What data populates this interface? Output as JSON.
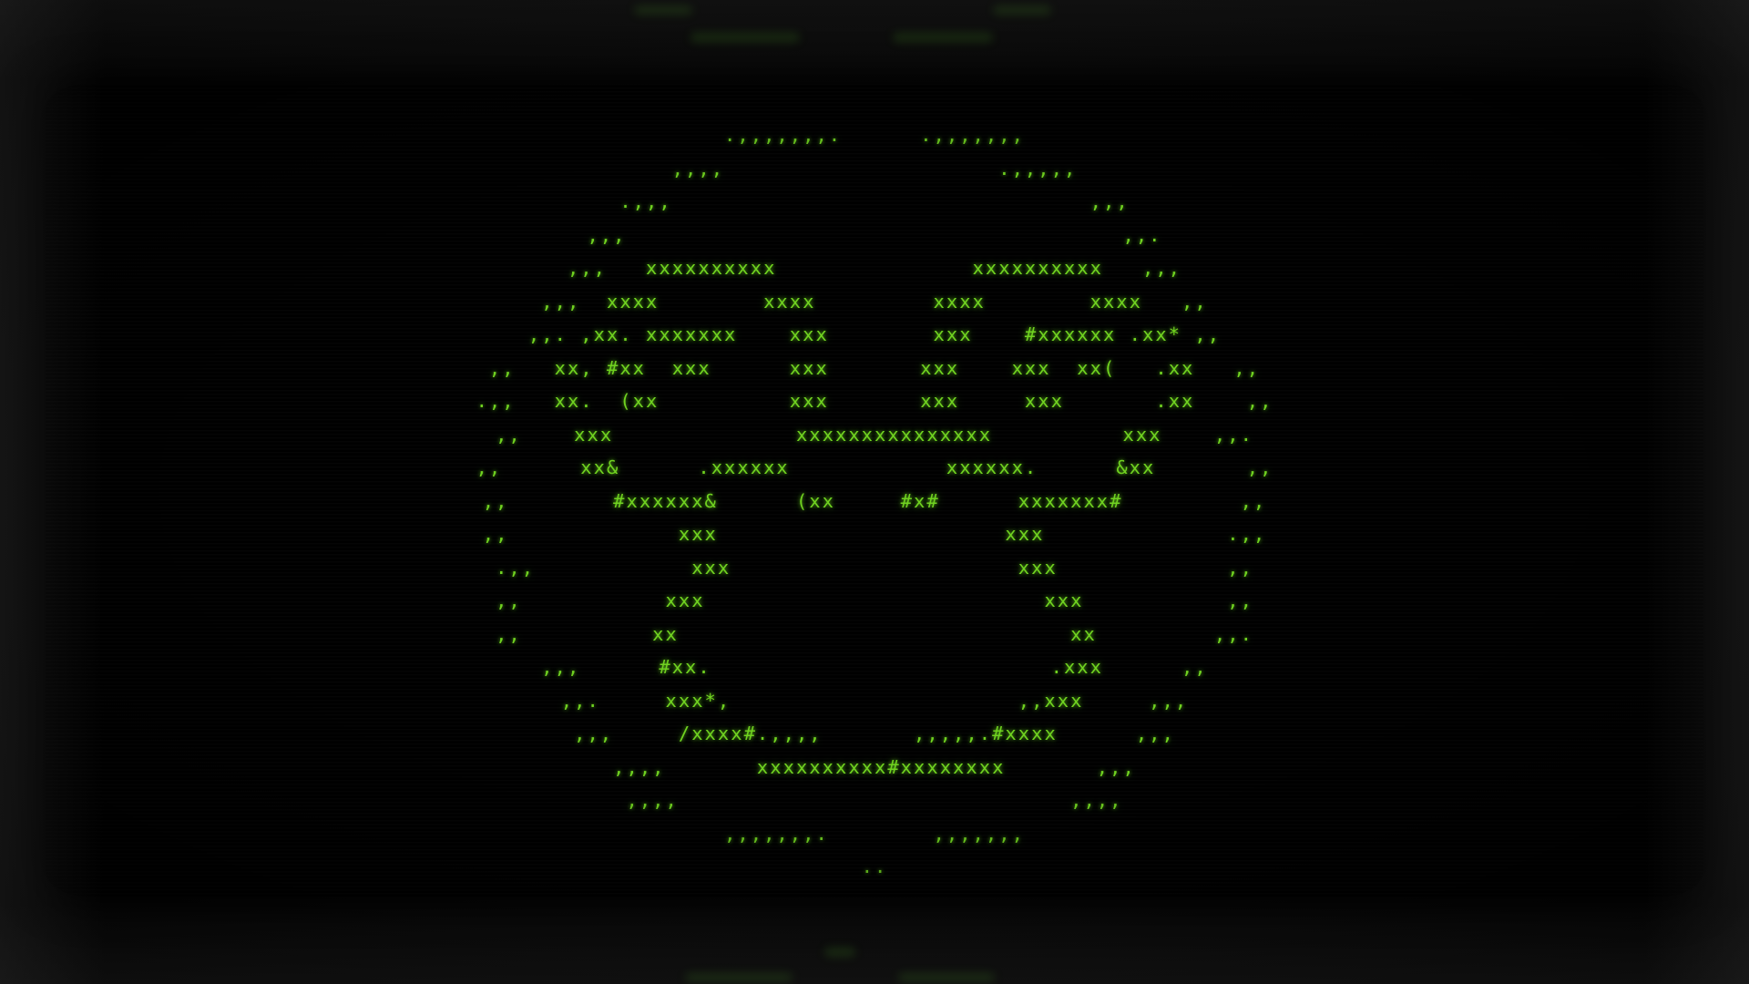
{
  "screen": {
    "colors": {
      "phosphor": "#6fd21f",
      "background": "#000000",
      "bezel": "#0a0a0a"
    },
    "ascii_lines": [
      "  .,,,,,,,.      .,,,,,,,  ",
      "  ,,,,                     .,,,,,  ",
      ".,,,                                ,,,",
      ",,,                                      ,,.",
      ",,,   xxxxxxxxxx               xxxxxxxxxx   ,,,",
      ",,,  xxxx        xxxx         xxxx        xxxx   ,,",
      ",,. ,xx. xxxxxxx    xxx        xxx    #xxxxxx .xx* ,,",
      ",,   xx, #xx  xxx      xxx       xxx    xxx  xx(   .xx   ,,",
      ".,,   xx.  (xx          xxx       xxx     xxx       .xx    ,,",
      ",,    xxx              xxxxxxxxxxxxxxx          xxx    ,,.",
      ",,      xx&      .xxxxxx            xxxxxx.      &xx       ,,",
      ",,        #xxxxxx&      (xx     #x#      xxxxxxx#         ,,",
      ",,             xxx                      xxx              .,,",
      ".,,            xxx                      xxx             ,,",
      ",,           xxx                          xxx           ,,",
      ",,          xx                              xx         ,,.",
      ",,,      #xx.                          .xxx      ,,",
      ",,.     xxx*,                      ,,xxx     ,,,",
      ",,,     /xxxx#.,,,,       ,,,,,.#xxxx      ,,,",
      ",,,,       xxxxxxxxxx#xxxxxxxx       ,,,",
      ",,,,                              ,,,,",
      ",,,,,,,.        ,,,,,,,",
      ".."
    ]
  }
}
